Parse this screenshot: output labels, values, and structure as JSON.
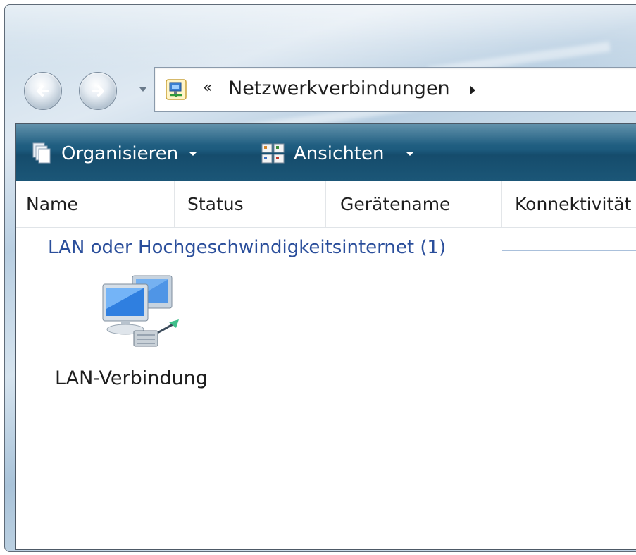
{
  "window": {
    "address": {
      "chevrons": "«",
      "path_label": "Netzwerkverbindungen"
    }
  },
  "toolbar": {
    "organize_label": "Organisieren",
    "views_label": "Ansichten"
  },
  "columns": [
    {
      "label": "Name"
    },
    {
      "label": "Status"
    },
    {
      "label": "Gerätename"
    },
    {
      "label": "Konnektivität"
    }
  ],
  "groups": [
    {
      "title": "LAN oder Hochgeschwindigkeitsinternet (1)",
      "items": [
        {
          "label": "LAN-Verbindung",
          "icon": "network-connection-icon"
        }
      ]
    }
  ],
  "colors": {
    "toolbar_bg": "#1d5b7e",
    "group_header": "#2a4e9b",
    "text": "#1e1e1e"
  }
}
